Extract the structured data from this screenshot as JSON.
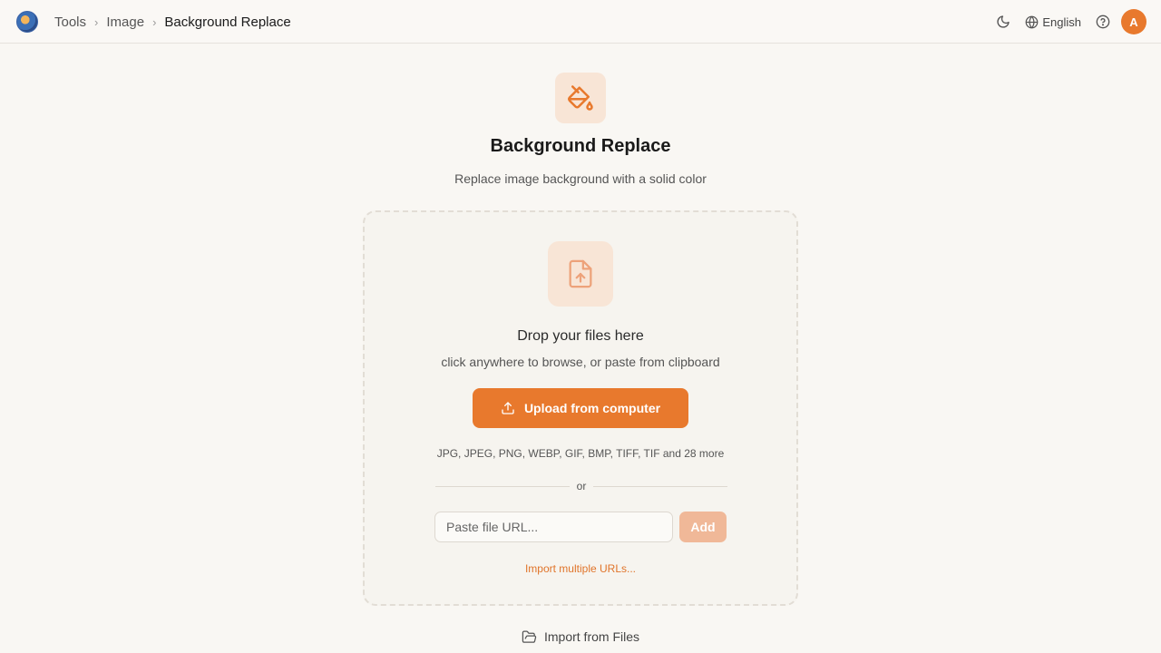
{
  "breadcrumb": [
    "Tools",
    "Image",
    "Background Replace"
  ],
  "header": {
    "language": "English",
    "avatar_initial": "A"
  },
  "tool": {
    "title": "Background Replace",
    "description": "Replace image background with a solid color"
  },
  "dropzone": {
    "title": "Drop your files here",
    "subtitle": "click anywhere to browse, or paste from clipboard",
    "upload_label": "Upload from computer",
    "formats": "JPG, JPEG, PNG, WEBP, GIF, BMP, TIFF, TIF and 28 more",
    "or": "or",
    "url_placeholder": "Paste file URL...",
    "add_label": "Add",
    "import_multiple": "Import multiple URLs..."
  },
  "import_files_label": "Import from Files",
  "colors": {
    "accent": "#e8792d",
    "accent_light": "#f8e5d6",
    "background": "#f9f7f3"
  }
}
